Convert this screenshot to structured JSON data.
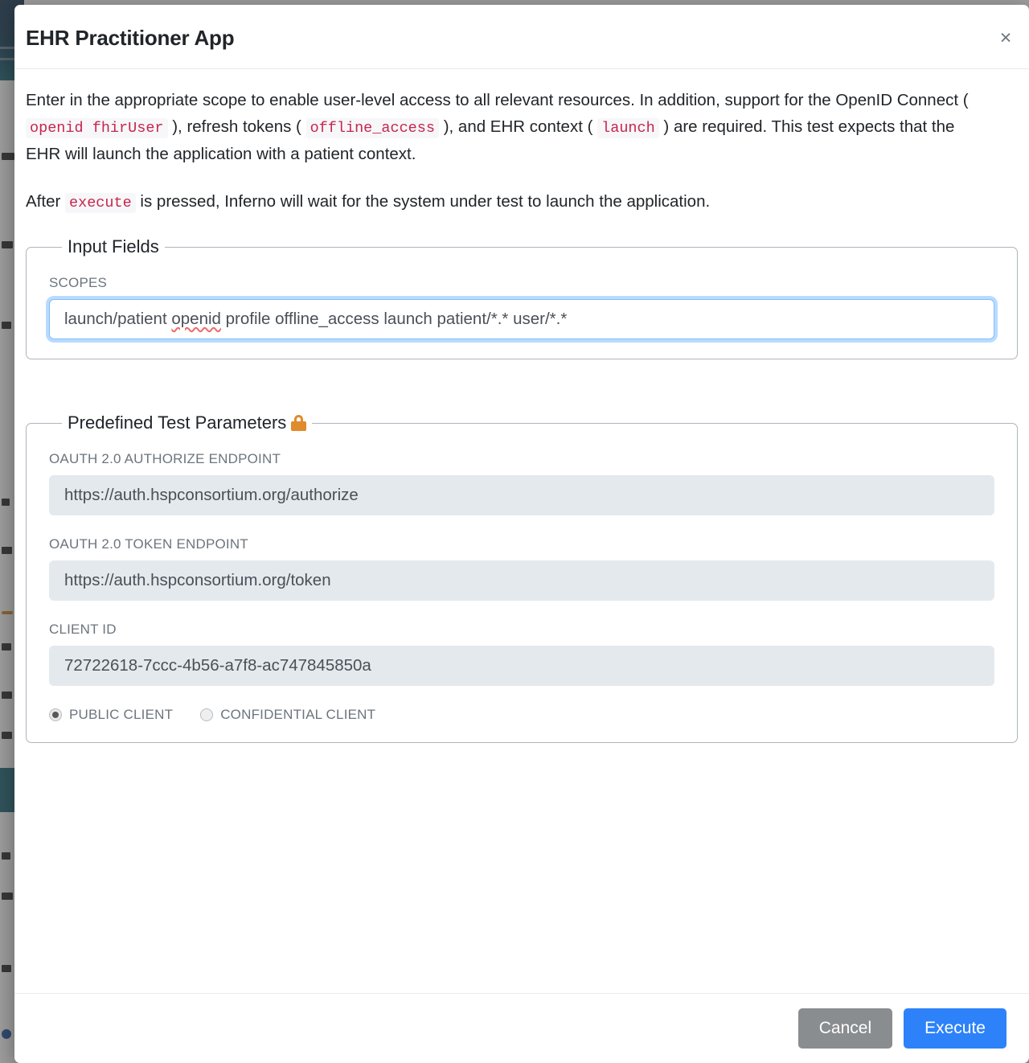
{
  "dialog": {
    "title": "EHR Practitioner App",
    "close_icon": "close-icon",
    "close_label": "×"
  },
  "description": {
    "paragraph1": {
      "part1": "Enter in the appropriate scope to enable user-level access to all relevant resources. In addition, support for the OpenID Connect ( ",
      "code1": "openid fhirUser",
      "part2": " ), refresh tokens ( ",
      "code2": "offline_access",
      "part3": " ), and EHR context ( ",
      "code3": "launch",
      "part4": " ) are required. This test expects that the EHR will launch the application with a patient context."
    },
    "paragraph2": {
      "part1": "After ",
      "code1": "execute",
      "part2": " is pressed, Inferno will wait for the system under test to launch the application."
    }
  },
  "input_fields": {
    "legend": "Input Fields",
    "scopes": {
      "label": "SCOPES",
      "value_before": "launch/patient ",
      "value_misspelled": "openid",
      "value_after": " profile offline_access launch patient/*.* user/*.*",
      "value_full": "launch/patient openid profile offline_access launch patient/*.* user/*.*",
      "placeholder": ""
    }
  },
  "predefined_parameters": {
    "legend": "Predefined Test Parameters",
    "lock_icon": "lock-icon",
    "lock_color": "#e08b2c",
    "fields": [
      {
        "label": "OAUTH 2.0 AUTHORIZE ENDPOINT",
        "value": "https://auth.hspconsortium.org/authorize",
        "disabled": true
      },
      {
        "label": "OAUTH 2.0 TOKEN ENDPOINT",
        "value": "https://auth.hspconsortium.org/token",
        "disabled": true
      },
      {
        "label": "CLIENT ID",
        "value": "72722618-7ccc-4b56-a7f8-ac747845850a",
        "disabled": true
      }
    ],
    "client_type": {
      "options": [
        {
          "label": "PUBLIC CLIENT",
          "selected": true
        },
        {
          "label": "CONFIDENTIAL CLIENT",
          "selected": false
        }
      ]
    }
  },
  "footer": {
    "cancel_label": "Cancel",
    "execute_label": "Execute",
    "cancel_color": "#8a8d90",
    "execute_color": "#2d82f9"
  }
}
